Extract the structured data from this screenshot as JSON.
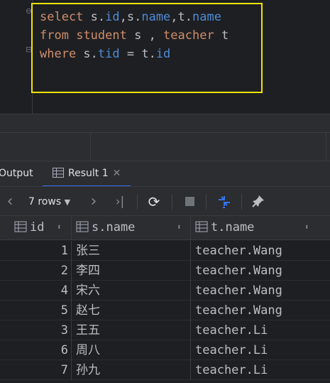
{
  "editor": {
    "lines": [
      [
        {
          "t": "select",
          "c": "kw"
        },
        {
          "t": " s.",
          "c": "plain"
        },
        {
          "t": "id",
          "c": "col"
        },
        {
          "t": ",s.",
          "c": "plain"
        },
        {
          "t": "name",
          "c": "col"
        },
        {
          "t": ",t.",
          "c": "plain"
        },
        {
          "t": "name",
          "c": "col"
        }
      ],
      [
        {
          "t": "from",
          "c": "kw"
        },
        {
          "t": " ",
          "c": "plain"
        },
        {
          "t": "student",
          "c": "kw"
        },
        {
          "t": " s , ",
          "c": "plain"
        },
        {
          "t": "teacher",
          "c": "kw"
        },
        {
          "t": " t",
          "c": "plain"
        }
      ],
      [
        {
          "t": "where",
          "c": "kw"
        },
        {
          "t": " s.",
          "c": "plain"
        },
        {
          "t": "tid",
          "c": "col"
        },
        {
          "t": " = t.",
          "c": "plain"
        },
        {
          "t": "id",
          "c": "col"
        }
      ]
    ]
  },
  "tabs": {
    "output_label": "Output",
    "result_label": "Result 1",
    "close_glyph": "✕"
  },
  "toolbar": {
    "rows_label": "7 rows",
    "prev_icon": "‹",
    "next_icon": "›",
    "last_icon": "›|"
  },
  "table": {
    "columns": [
      "id",
      "s.name",
      "t.name"
    ],
    "rows": [
      {
        "id": "1",
        "s_name": "张三",
        "t_name": "teacher.Wang"
      },
      {
        "id": "2",
        "s_name": "李四",
        "t_name": "teacher.Wang"
      },
      {
        "id": "4",
        "s_name": "宋六",
        "t_name": "teacher.Wang"
      },
      {
        "id": "5",
        "s_name": "赵七",
        "t_name": "teacher.Wang"
      },
      {
        "id": "3",
        "s_name": "王五",
        "t_name": "teacher.Li"
      },
      {
        "id": "6",
        "s_name": "周八",
        "t_name": "teacher.Li"
      },
      {
        "id": "7",
        "s_name": "孙九",
        "t_name": "teacher.Li"
      }
    ]
  },
  "colors": {
    "keyword": "#cf8e6d",
    "column": "#4f8bd6",
    "highlight": "#f2e300",
    "tab_underline": "#3574f0"
  }
}
